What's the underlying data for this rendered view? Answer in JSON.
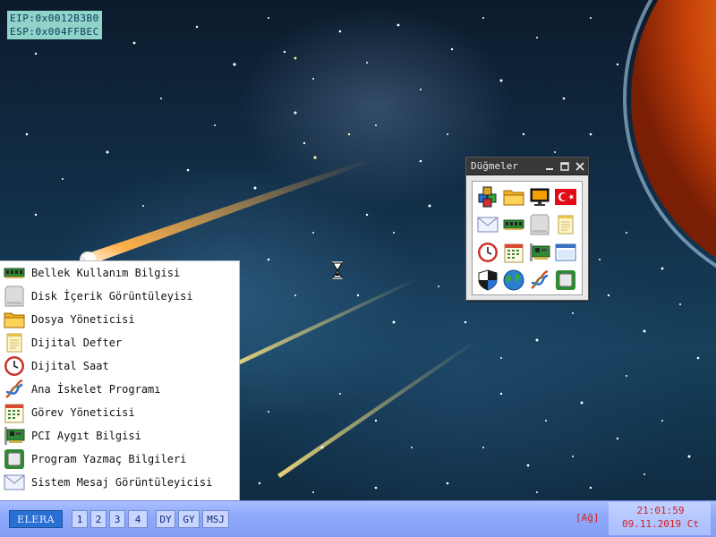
{
  "registers": {
    "eip": "EIP:0x0012B3B0",
    "esp": "ESP:0x004FFBEC"
  },
  "buttons_window": {
    "title": "Düğmeler",
    "buttons": [
      {
        "icon": "blocks-icon"
      },
      {
        "icon": "folder-icon"
      },
      {
        "icon": "monitor-icon"
      },
      {
        "icon": "turkish-flag-icon"
      },
      {
        "icon": "envelope-icon"
      },
      {
        "icon": "memory-module-icon"
      },
      {
        "icon": "disk-icon"
      },
      {
        "icon": "notepad-icon"
      },
      {
        "icon": "clock-icon"
      },
      {
        "icon": "calendar-icon"
      },
      {
        "icon": "pci-card-icon"
      },
      {
        "icon": "window-icon"
      },
      {
        "icon": "shield-icon"
      },
      {
        "icon": "globe-icon"
      },
      {
        "icon": "dna-icon"
      },
      {
        "icon": "chip-icon"
      }
    ]
  },
  "start_menu": {
    "items": [
      {
        "label": "Bellek Kullanım Bilgisi",
        "icon": "memory-module-icon"
      },
      {
        "label": "Disk İçerik Görüntüleyisi",
        "icon": "disk-icon"
      },
      {
        "label": "Dosya Yöneticisi",
        "icon": "folder-icon"
      },
      {
        "label": "Dijital Defter",
        "icon": "notepad-icon"
      },
      {
        "label": "Dijital Saat",
        "icon": "clock-icon"
      },
      {
        "label": "Ana İskelet Programı",
        "icon": "dna-icon"
      },
      {
        "label": "Görev Yöneticisi",
        "icon": "calendar-icon"
      },
      {
        "label": "PCI Aygıt Bilgisi",
        "icon": "pci-card-icon"
      },
      {
        "label": "Program Yazmaç Bilgileri",
        "icon": "chip-icon"
      },
      {
        "label": "Sistem Mesaj Görüntüleyicisi",
        "icon": "envelope-icon"
      }
    ]
  },
  "taskbar": {
    "start_label": "ELERA",
    "workspaces": [
      "1",
      "2",
      "3",
      "4"
    ],
    "shortcuts": [
      "DY",
      "GY",
      "MSJ"
    ],
    "network": "[Ağ]",
    "time": "21:01:59",
    "date": "09.11.2019 Ct"
  },
  "colors": {
    "taskbar": "#8fa9fb",
    "start_button": "#2a6fd4",
    "clock_text": "#d42020",
    "register_box": "#8fd3c9"
  }
}
